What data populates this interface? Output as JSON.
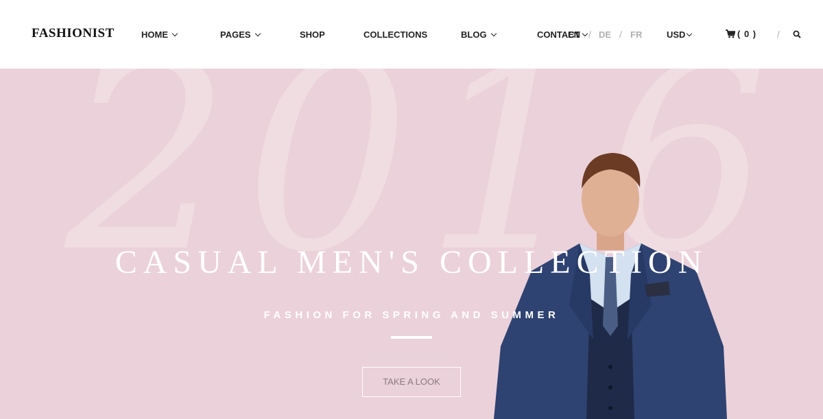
{
  "brand": {
    "name": "FASHIONIST"
  },
  "nav": {
    "home": "HOME",
    "pages": "PAGES",
    "shop": "SHOP",
    "collections": "COLLECTIONS",
    "blog": "BLOG",
    "contact": "CONTACT"
  },
  "languages": {
    "en": "EN",
    "de": "DE",
    "fr": "FR",
    "separator": "/"
  },
  "currency": {
    "selected": "USD"
  },
  "cart": {
    "count_label": "( 0 )"
  },
  "hero": {
    "background_text": "2016",
    "title": "CASUAL MEN'S COLLECTION",
    "subtitle": "FASHION FOR SPRING AND SUMMER",
    "cta_label": "TAKE A LOOK"
  },
  "colors": {
    "hero_background": "#ebd1d9",
    "suit_blue": "#2f4372",
    "text_dark": "#222222"
  }
}
